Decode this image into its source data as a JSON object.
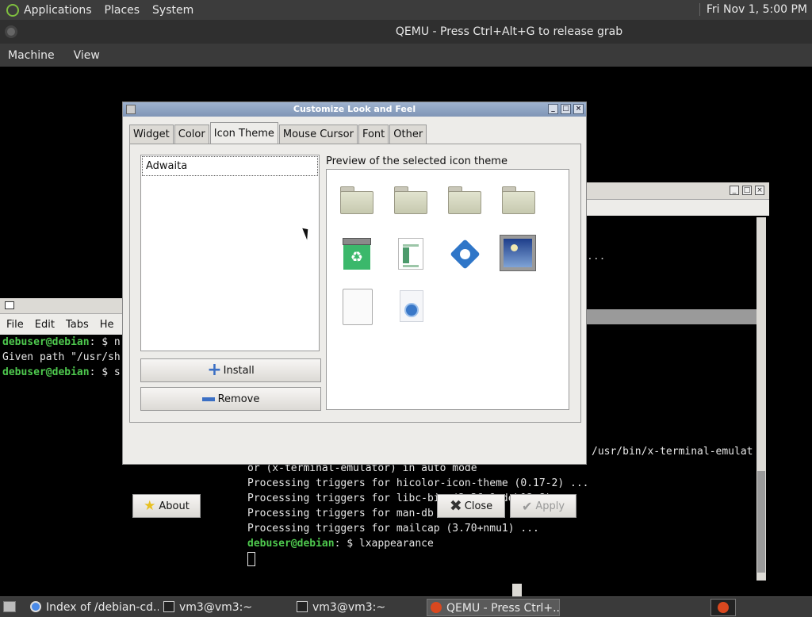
{
  "top_panel": {
    "menus": [
      "Applications",
      "Places",
      "System"
    ],
    "clock": "Fri Nov  1,  5:00 PM"
  },
  "qemu": {
    "title": "QEMU - Press Ctrl+Alt+G to release grab",
    "menu": [
      "Machine",
      "View"
    ]
  },
  "dialog": {
    "title": "Customize Look and Feel",
    "tabs": [
      "Widget",
      "Color",
      "Icon Theme",
      "Mouse Cursor",
      "Font",
      "Other"
    ],
    "active_tab": "Icon Theme",
    "themes": [
      "Adwaita"
    ],
    "install_label": "Install",
    "remove_label": "Remove",
    "preview_label": "Preview of the selected icon theme",
    "preview_icons": [
      "folder-icon",
      "folder-icon",
      "folder-icon",
      "folder-icon",
      "trash-icon",
      "document-icon",
      "gear-icon",
      "image-icon",
      "blank-file-icon",
      "web-file-icon"
    ],
    "about_label": "About",
    "close_label": "Close",
    "apply_label": "Apply"
  },
  "left_terminal": {
    "menu": [
      "File",
      "Edit",
      "Tabs",
      "He"
    ],
    "lines": [
      {
        "prompt": "debuser@debian",
        "rest": ": $ n"
      },
      {
        "prompt": "",
        "rest": "Given path \"/usr/sh"
      },
      {
        "prompt": "debuser@debian",
        "rest": ": $ s"
      }
    ]
  },
  "right_terminal": {
    "dots": "...",
    "buttons": [
      "_",
      "□",
      "×"
    ]
  },
  "main_terminal": {
    "right_text": "/usr/bin/x-terminal-emulat",
    "lines": [
      {
        "prompt": "",
        "rest": "or (x-terminal-emulator) in auto mode"
      },
      {
        "prompt": "",
        "rest": "Processing triggers for hicolor-icon-theme (0.17-2) ..."
      },
      {
        "prompt": "",
        "rest": "Processing triggers for libc-bin (2.36-9+deb12u8) ..."
      },
      {
        "prompt": "",
        "rest": "Processing triggers for man-db (2.11.2-2) ..."
      },
      {
        "prompt": "",
        "rest": "Processing triggers for mailcap (3.70+nmu1) ..."
      },
      {
        "prompt": "debuser@debian",
        "rest": ": $ lxappearance"
      }
    ]
  },
  "taskbar": {
    "tasks": [
      {
        "label": "Index of /debian-cd...",
        "icon": "browser-icon",
        "active": false
      },
      {
        "label": "vm3@vm3:~",
        "icon": "terminal-icon",
        "active": false
      },
      {
        "label": "vm3@vm3:~",
        "icon": "terminal-icon",
        "active": false
      },
      {
        "label": "QEMU - Press Ctrl+...",
        "icon": "qemu-icon",
        "active": true
      }
    ]
  }
}
